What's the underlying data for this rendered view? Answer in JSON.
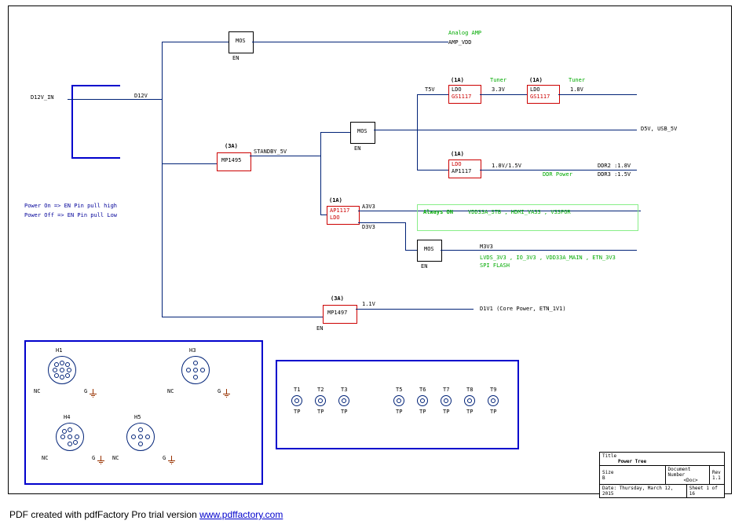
{
  "input": {
    "d12v_in": "D12V_IN",
    "d12v": "D12V"
  },
  "mos": {
    "label": "MOS",
    "en": "EN"
  },
  "amp": {
    "analog": "Analog AMP",
    "vdd": "AMP_VDD"
  },
  "mp1495": {
    "rating": "(3A)",
    "name": "MP1495",
    "out": "STANDBY_5V"
  },
  "t5v": "T5V",
  "ldo1": {
    "rating": "(1A)",
    "type": "LDO",
    "part": "GS1117",
    "v": "3.3V",
    "note": "Tuner"
  },
  "ldo2": {
    "rating": "(1A)",
    "type": "LDO",
    "part": "GS1117",
    "v": "1.8V",
    "note": "Tuner"
  },
  "d5v": "D5V, USB_5V",
  "ddr": {
    "rating": "(1A)",
    "type": "LDO",
    "part": "AP1117",
    "v": "1.8V/1.5V",
    "note": "DDR Power",
    "l1": "DDR2 :1.8V",
    "l2": "DDR3 :1.5V"
  },
  "ap1117": {
    "rating": "(1A)",
    "name": "AP1117",
    "type": "LDO",
    "a3v3": "A3V3",
    "d3v3": "D3V3"
  },
  "always": {
    "on": "Always ON",
    "rails": "VDD33A_STB , HDMI_VA33 , V33POR"
  },
  "m3v3": {
    "name": "M3V3",
    "rails": "LVDS_3V3 , IO_3V3 , VDD33A_MAIN , ETN_3V3",
    "spi": "SPI FLASH"
  },
  "mp1497": {
    "rating": "(3A)",
    "name": "MP1497",
    "v": "1.1V",
    "out": "D1V1 (Core Power, ETN_1V1)",
    "en": "EN"
  },
  "notes": {
    "on": "Power On => EN Pin pull high",
    "off": "Power Off => EN Pin pull Low"
  },
  "conn": {
    "h1": "H1",
    "h3": "H3",
    "h4": "H4",
    "h5": "H5",
    "nc": "NC",
    "g": "G"
  },
  "tp": {
    "t1": "T1",
    "t2": "T2",
    "t3": "T3",
    "t5": "T5",
    "t6": "T6",
    "t7": "T7",
    "t8": "T8",
    "t9": "T9",
    "lbl": "TP"
  },
  "title": {
    "block": "Title",
    "name": "Power Tree",
    "size": "Size",
    "sizev": "B",
    "docn": "Document Number",
    "docv": "<Doc>",
    "rev": "Rev",
    "revv": "1.1",
    "date": "Date:",
    "datev": "Thursday, March 12, 2015",
    "sheet": "Sheet",
    "of": "of",
    "p": "1",
    "t": "16"
  },
  "footer": {
    "txt": "PDF created with pdfFactory Pro trial version ",
    "url": "www.pdffactory.com"
  }
}
